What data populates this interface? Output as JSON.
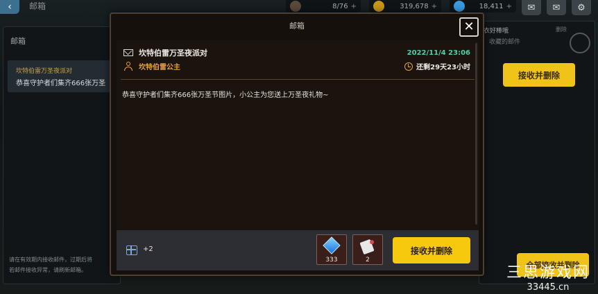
{
  "hud": {
    "title": "邮箱",
    "resources": [
      {
        "icon": "energy-icon",
        "value": "8/76"
      },
      {
        "icon": "gold-coin-icon",
        "value": "319,678"
      },
      {
        "icon": "diamond-icon",
        "value": "18,411"
      }
    ],
    "buttons": [
      "chat-icon",
      "mail-icon",
      "settings-icon"
    ]
  },
  "left_panel": {
    "title": "邮箱",
    "item": {
      "sender": "坎特伯雷万圣夜派对",
      "preview": "恭喜守护者们集齐666张万圣"
    },
    "footer_line1": "请在有效期内接收邮件，过期后将",
    "footer_line2": "若邮件接收异常，请刷新邮箱。"
  },
  "right_panel": {
    "title": "衣好棒哦",
    "close_label": "删除",
    "sub": "收藏的邮件",
    "accept_label": "接收并删除",
    "accept_all_label": "全部接收并删除"
  },
  "dialog": {
    "title": "邮箱",
    "subject": "坎特伯雷万圣夜派对",
    "date": "2022/11/4 23:06",
    "sender": "坎特伯雷公主",
    "remaining": "还剩29天23小时",
    "body": "恭喜守护者们集齐666张万圣节图片，小公主为您送上万圣夜礼物~",
    "extra_count": "+2",
    "attachments": [
      {
        "icon": "diamond-icon",
        "qty": "333"
      },
      {
        "icon": "scroll-icon",
        "qty": "2"
      }
    ],
    "accept_label": "接收并删除"
  },
  "watermark": {
    "logo": "三思游戏网",
    "site": "33445.cn"
  },
  "colors": {
    "accent_yellow": "#f6c90f",
    "date_green": "#4fd0a8",
    "sender_orange": "#e7a33a"
  }
}
